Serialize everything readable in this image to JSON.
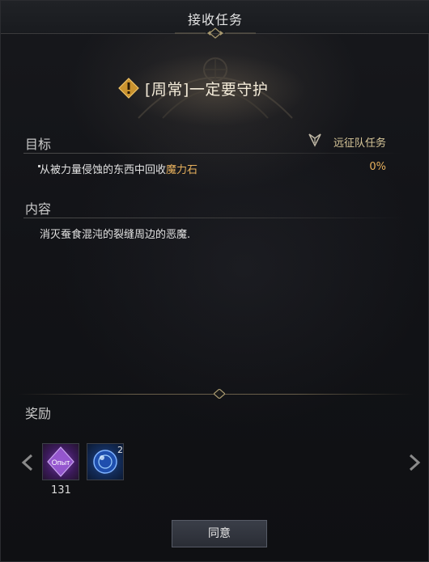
{
  "window": {
    "title": "接收任务"
  },
  "quest": {
    "title": "[周常]一定要守护",
    "icon": "exclamation-quest-icon"
  },
  "objective": {
    "section_label": "目标",
    "tag": "远征队任务",
    "tag_icon": "expedition-crest-icon",
    "text_prefix": "从被力量侵蚀的东西中回收",
    "text_highlight": "魔力石",
    "progress": "0%"
  },
  "content": {
    "section_label": "内容",
    "text": "消灭蚕食混沌的裂缝周边的恶魔."
  },
  "rewards": {
    "section_label": "奖励",
    "items": [
      {
        "icon": "purple-exp-crystal-icon",
        "label": "Опыт",
        "count": "131"
      },
      {
        "icon": "blue-orb-icon",
        "badge": "2"
      }
    ]
  },
  "actions": {
    "accept_label": "同意"
  },
  "colors": {
    "highlight": "#e8b15d",
    "tag": "#d9c89a"
  }
}
